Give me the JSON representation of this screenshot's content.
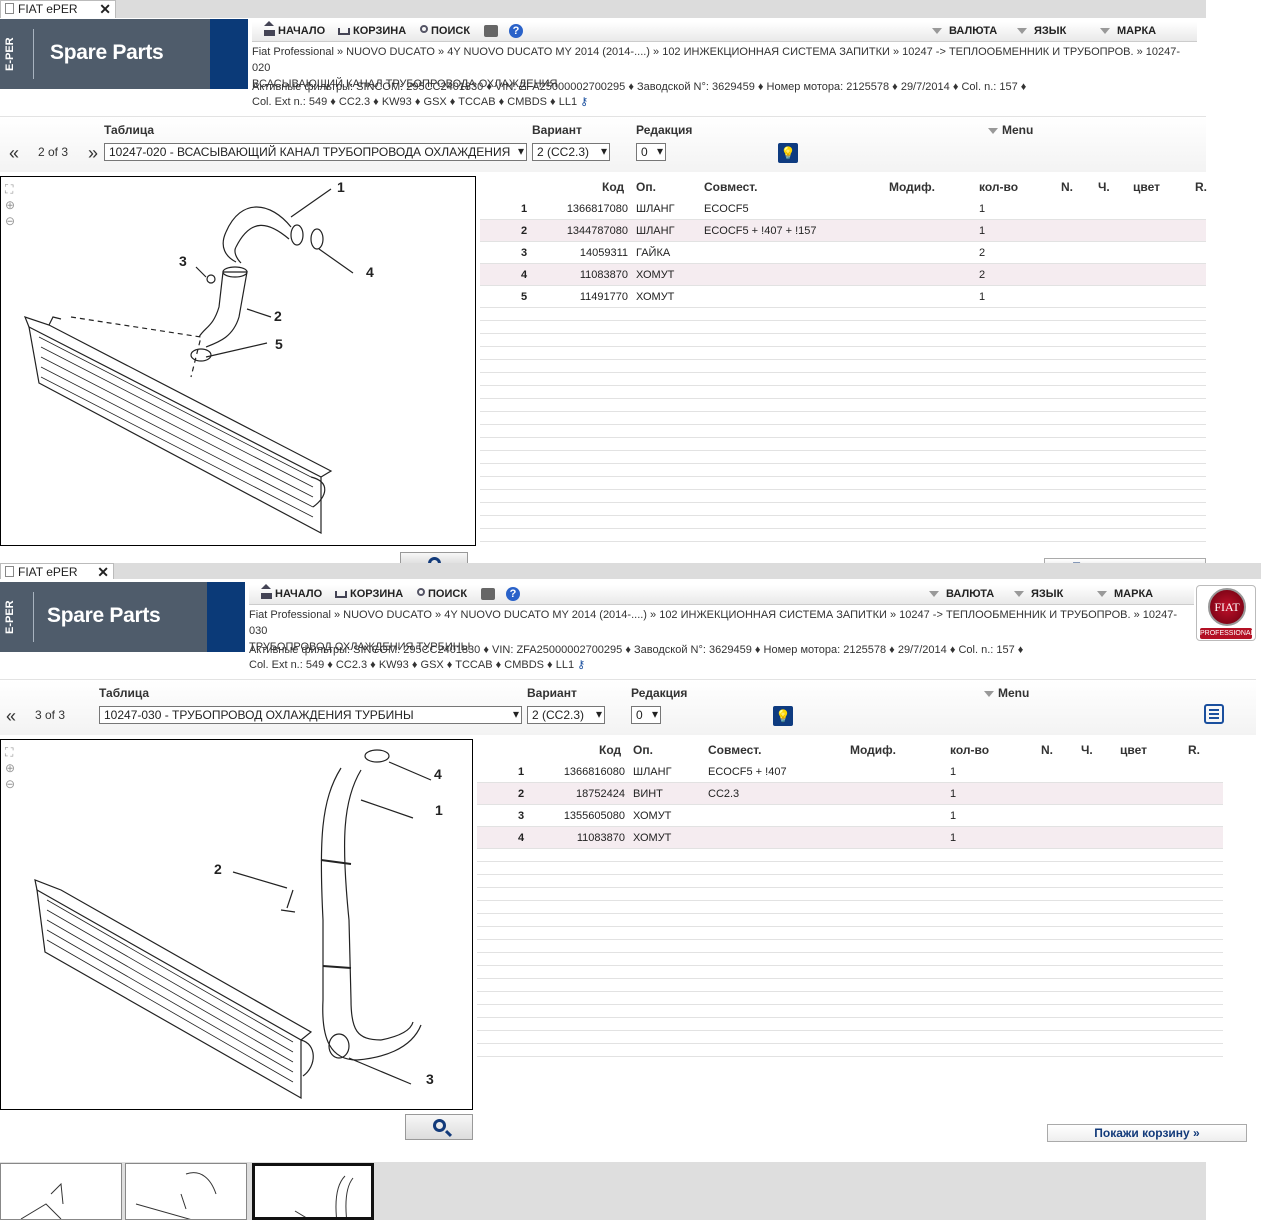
{
  "tab_title": "FIAT ePER",
  "logo": {
    "eper": "E-PER",
    "title": "Spare Parts"
  },
  "nav": {
    "home": "НАЧАЛО",
    "cart": "КОРЗИНА",
    "search": "ПОИСК",
    "help": "?",
    "currency": "ВАЛЮТА",
    "language": "ЯЗЫК",
    "brand": "МАРКА"
  },
  "filters": {
    "line1": "Активные фильтры: SINCOM: 295CC2401830 ♦ VIN: ZFA25000002700295 ♦ Заводской N°: 3629459 ♦ Номер мотора: 2125578 ♦ 29/7/2014 ♦ Col. n.: 157 ♦",
    "line2": "Col. Ext n.: 549 ♦ CC2.3 ♦ KW93 ♦ GSX ♦ TCCAB ♦ CMBDS ♦ LL1"
  },
  "labels": {
    "table": "Таблица",
    "variant": "Вариант",
    "edition": "Редакция",
    "menu": "Menu",
    "prev": "«",
    "next": "»"
  },
  "columns": {
    "code": "Код",
    "op": "Оп.",
    "compat": "Совмест.",
    "modif": "Модиф.",
    "qty": "кол-во",
    "n": "N.",
    "ch": "Ч.",
    "color": "цвет",
    "r": "R."
  },
  "cart_button": "Покажи корзину »",
  "badge": {
    "brand": "FIAT",
    "sub": "PROFESSIONAL"
  },
  "window1": {
    "breadcrumb1": "Fiat Professional » NUOVO DUCATO » 4Y NUOVO DUCATO MY 2014 (2014-....) » 102 ИНЖЕКЦИОННАЯ СИСТЕМА ЗАПИТКИ » 10247 -> ТЕПЛООБМЕННИК И ТРУБОПРОВ. » 10247-020",
    "breadcrumb2": "ВСАСЫВАЮЩИЙ КАНАЛ ТРУБОПРОВОДА ОХЛАЖДЕНИЯ",
    "page_of": "2 of 3",
    "table_select": "10247-020 - ВСАСЫВАЮЩИЙ КАНАЛ ТРУБОПРОВОДА ОХЛАЖДЕНИЯ",
    "variant_select": "2 (CC2.3)",
    "edition_select": "0",
    "callouts": [
      "1",
      "2",
      "3",
      "4",
      "5"
    ],
    "rows": [
      {
        "n": "1",
        "code": "1366817080",
        "op": "ШЛАНГ",
        "compat": "ECOCF5",
        "qty": "1"
      },
      {
        "n": "2",
        "code": "1344787080",
        "op": "ШЛАНГ",
        "compat": "ECOCF5 + !407 + !157",
        "qty": "1"
      },
      {
        "n": "3",
        "code": "14059311",
        "op": "ГАЙКА",
        "compat": "",
        "qty": "2"
      },
      {
        "n": "4",
        "code": "11083870",
        "op": "ХОМУТ",
        "compat": "",
        "qty": "2"
      },
      {
        "n": "5",
        "code": "11491770",
        "op": "ХОМУТ",
        "compat": "",
        "qty": "1"
      }
    ]
  },
  "window2": {
    "breadcrumb1": "Fiat Professional » NUOVO DUCATO » 4Y NUOVO DUCATO MY 2014 (2014-....) » 102 ИНЖЕКЦИОННАЯ СИСТЕМА ЗАПИТКИ » 10247 -> ТЕПЛООБМЕННИК И ТРУБОПРОВ. » 10247-030",
    "breadcrumb2": "ТРУБОПРОВОД ОХЛАЖДЕНИЯ ТУРБИНЫ",
    "page_of": "3 of 3",
    "table_select": "10247-030 - ТРУБОПРОВОД ОХЛАЖДЕНИЯ ТУРБИНЫ",
    "variant_select": "2 (CC2.3)",
    "edition_select": "0",
    "callouts": [
      "1",
      "2",
      "3",
      "4"
    ],
    "rows": [
      {
        "n": "1",
        "code": "1366816080",
        "op": "ШЛАНГ",
        "compat": "ECOCF5 + !407",
        "qty": "1"
      },
      {
        "n": "2",
        "code": "18752424",
        "op": "ВИНТ",
        "compat": "CC2.3",
        "qty": "1"
      },
      {
        "n": "3",
        "code": "1355605080",
        "op": "ХОМУТ",
        "compat": "",
        "qty": "1"
      },
      {
        "n": "4",
        "code": "11083870",
        "op": "ХОМУТ",
        "compat": "",
        "qty": "1"
      }
    ]
  }
}
